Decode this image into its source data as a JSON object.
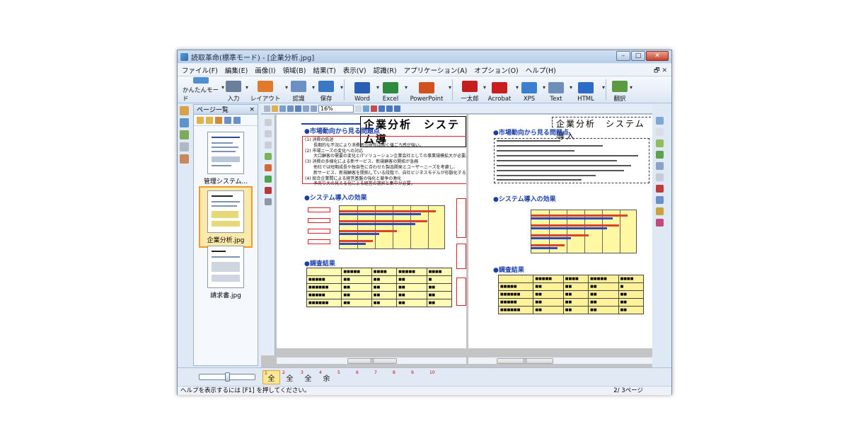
{
  "window": {
    "title": "読取革命(標準モード) - [企業分析.jpg]"
  },
  "menu": [
    "ファイル(F)",
    "編集(E)",
    "画像(I)",
    "領域(B)",
    "結果(T)",
    "表示(V)",
    "認識(R)",
    "アプリケーション(A)",
    "オプション(O)",
    "ヘルプ(H)"
  ],
  "toolbar": {
    "buttons": [
      {
        "label": "かんたんモード",
        "icon": "easy-mode-icon",
        "color": "#4f8fd0"
      },
      {
        "label": "入力",
        "icon": "scan-input-icon",
        "color": "#6a7f99"
      },
      {
        "label": "レイアウト",
        "icon": "layout-icon",
        "color": "#e07b2e"
      },
      {
        "label": "認識",
        "icon": "recognize-icon",
        "color": "#6c8fc4"
      },
      {
        "label": "保存",
        "icon": "save-icon",
        "color": "#3b78c2"
      },
      {
        "label": "Word",
        "icon": "word-icon",
        "color": "#2a5fb4"
      },
      {
        "label": "Excel",
        "icon": "excel-icon",
        "color": "#2d8a3e"
      },
      {
        "label": "PowerPoint",
        "icon": "powerpoint-icon",
        "color": "#d0521f"
      },
      {
        "label": "一太郎",
        "icon": "ichitaro-icon",
        "color": "#c41e1e"
      },
      {
        "label": "Acrobat",
        "icon": "acrobat-icon",
        "color": "#c81e1e"
      },
      {
        "label": "XPS",
        "icon": "xps-icon",
        "color": "#3d7fcf"
      },
      {
        "label": "Text",
        "icon": "text-icon",
        "color": "#6d8fb8"
      },
      {
        "label": "HTML",
        "icon": "html-icon",
        "color": "#2c6cc8"
      },
      {
        "label": "翻訳",
        "icon": "translate-icon",
        "color": "#5a9a40"
      }
    ]
  },
  "page_panel": {
    "title": "ページ一覧",
    "close": "×",
    "pages": [
      {
        "label": "管理システム..."
      },
      {
        "label": "企業分析.jpg",
        "selected": true
      },
      {
        "label": "請求書.jpg"
      }
    ]
  },
  "viewer": {
    "zoom": "16%"
  },
  "document": {
    "title": "企業分析　システム導",
    "right_title": "企業分析　システム導入",
    "sec1": "●市場動向から見る問題点",
    "sec1_text": "(1) 消費の低迷\n　　長期的な不況により消費者の財布は固く値ごろ感が強い。\n(2) 市場ニーズの変化への対応\n　　大口顧客の需要の変化とITソリューション企業会社としての事業規模拡大が必要。\n(3) 消費の多様化による新サービス、新規顧客の開拓が急務\n　　他社では短期成長や独自性に合わせた製品開発とユーザーニーズを考慮し、\n　　新サービス、新規顧客を開拓している段階で、自社ビジネスモデルが形骸化する\n(4) 総合企業間による経営基盤の強化と競争の激化\n　　予売り大の見える化による経営の選択と集中が必要。",
    "sec2": "●システム導入の効果",
    "sec3": "●調査結果",
    "chart_labels": [
      "■■■■",
      "■■■■■■",
      "■■■■■",
      "■■■■■"
    ],
    "table_head": [
      "",
      "■■■■■",
      "■■■■",
      "■■■■■",
      "■■■■"
    ],
    "table_rows": [
      [
        "■■■■■",
        "■■",
        "■■",
        "■■",
        "■"
      ],
      [
        "■■■■■■",
        "■■",
        "■■",
        "■■",
        "■■"
      ],
      [
        "■■■■■",
        "■■",
        "■■",
        "■■",
        "■■"
      ],
      [
        "■■■■■■",
        "■■",
        "■■",
        "■■",
        "■■"
      ]
    ],
    "right_sec1": "●市場動向から見る問題点",
    "right_sec2": "●システム導入の効果",
    "right_sec3": "●調査結果"
  },
  "page_tabs": [
    {
      "num": "1",
      "label": "全",
      "active": true
    },
    {
      "num": "2",
      "label": "全"
    },
    {
      "num": "3",
      "label": "全"
    },
    {
      "num": "4",
      "label": "余"
    },
    {
      "num": "5",
      "label": ""
    },
    {
      "num": "6",
      "label": ""
    },
    {
      "num": "7",
      "label": ""
    },
    {
      "num": "8",
      "label": ""
    },
    {
      "num": "9",
      "label": ""
    },
    {
      "num": "10",
      "label": ""
    }
  ],
  "status": {
    "help": "ヘルプを表示するには [F1] を押してください。",
    "page": "2/ 3ページ"
  },
  "colors": {
    "bar_red": "#d8452b",
    "bar_blue": "#2b49c2",
    "chart_bg": "#fff8a3",
    "accent": "#1a3fa8"
  }
}
